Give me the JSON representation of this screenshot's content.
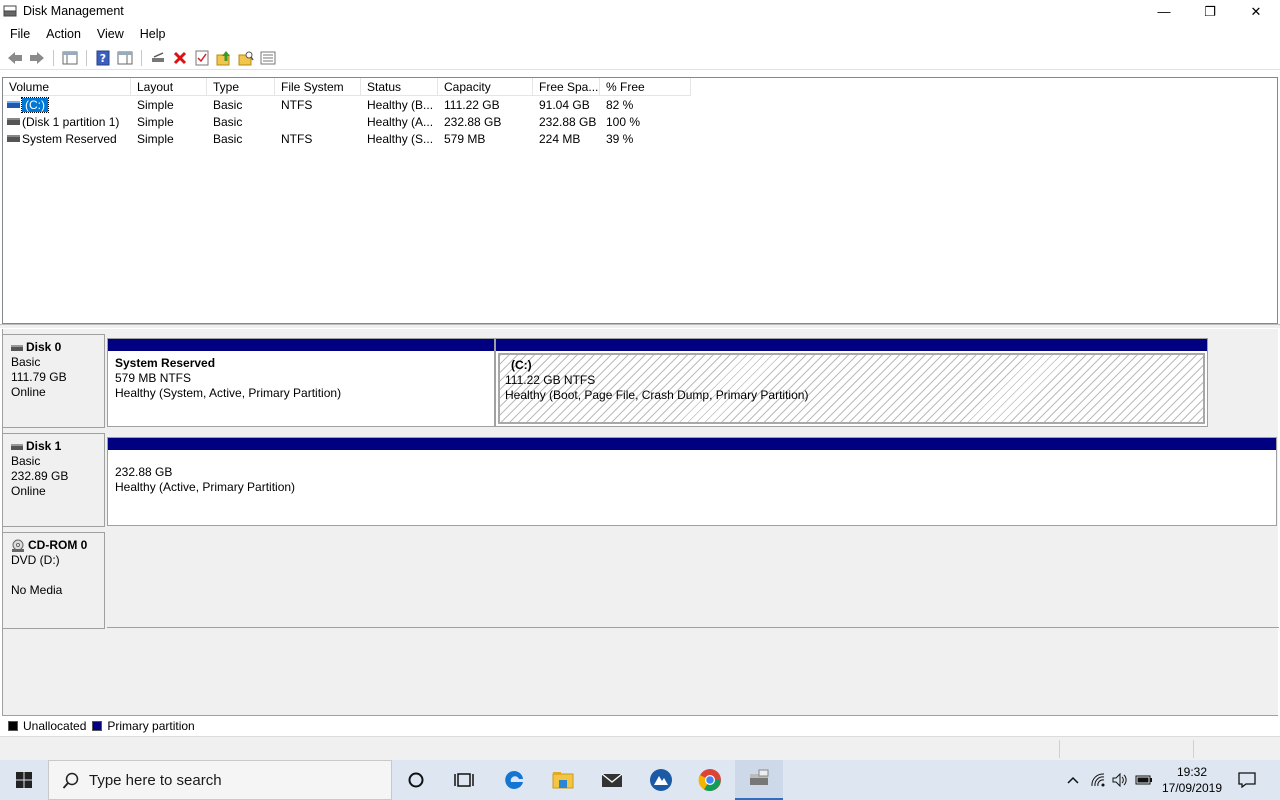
{
  "window": {
    "title": "Disk Management",
    "minimize": "—",
    "restore": "❐",
    "close": "✕"
  },
  "menu": [
    "File",
    "Action",
    "View",
    "Help"
  ],
  "volume_list": {
    "columns": [
      "Volume",
      "Layout",
      "Type",
      "File System",
      "Status",
      "Capacity",
      "Free Spa...",
      "% Free"
    ],
    "rows": [
      {
        "volume": "(C:)",
        "layout": "Simple",
        "type": "Basic",
        "fs": "NTFS",
        "status": "Healthy (B...",
        "capacity": "111.22 GB",
        "free": "91.04 GB",
        "pct": "82 %"
      },
      {
        "volume": "(Disk 1 partition 1)",
        "layout": "Simple",
        "type": "Basic",
        "fs": "",
        "status": "Healthy (A...",
        "capacity": "232.88 GB",
        "free": "232.88 GB",
        "pct": "100 %"
      },
      {
        "volume": "System Reserved",
        "layout": "Simple",
        "type": "Basic",
        "fs": "NTFS",
        "status": "Healthy (S...",
        "capacity": "579 MB",
        "free": "224 MB",
        "pct": "39 %"
      }
    ]
  },
  "disks": [
    {
      "name": "Disk 0",
      "type": "Basic",
      "size": "111.79 GB",
      "state": "Online",
      "partitions": [
        {
          "name": "System Reserved",
          "size": "579 MB NTFS",
          "status": "Healthy (System, Active, Primary Partition)"
        },
        {
          "name": "(C:)",
          "size": "111.22 GB NTFS",
          "status": "Healthy (Boot, Page File, Crash Dump, Primary Partition)"
        }
      ]
    },
    {
      "name": "Disk 1",
      "type": "Basic",
      "size": "232.89 GB",
      "state": "Online",
      "partitions": [
        {
          "name": "",
          "size": "232.88 GB",
          "status": "Healthy (Active, Primary Partition)"
        }
      ]
    },
    {
      "name": "CD-ROM 0",
      "type": "DVD (D:)",
      "size": "",
      "state": "No Media"
    }
  ],
  "legend": [
    {
      "label": "Unallocated",
      "color": "#000000"
    },
    {
      "label": "Primary partition",
      "color": "#000080"
    }
  ],
  "taskbar": {
    "search_placeholder": "Type here to search",
    "time": "19:32",
    "date": "17/09/2019"
  }
}
